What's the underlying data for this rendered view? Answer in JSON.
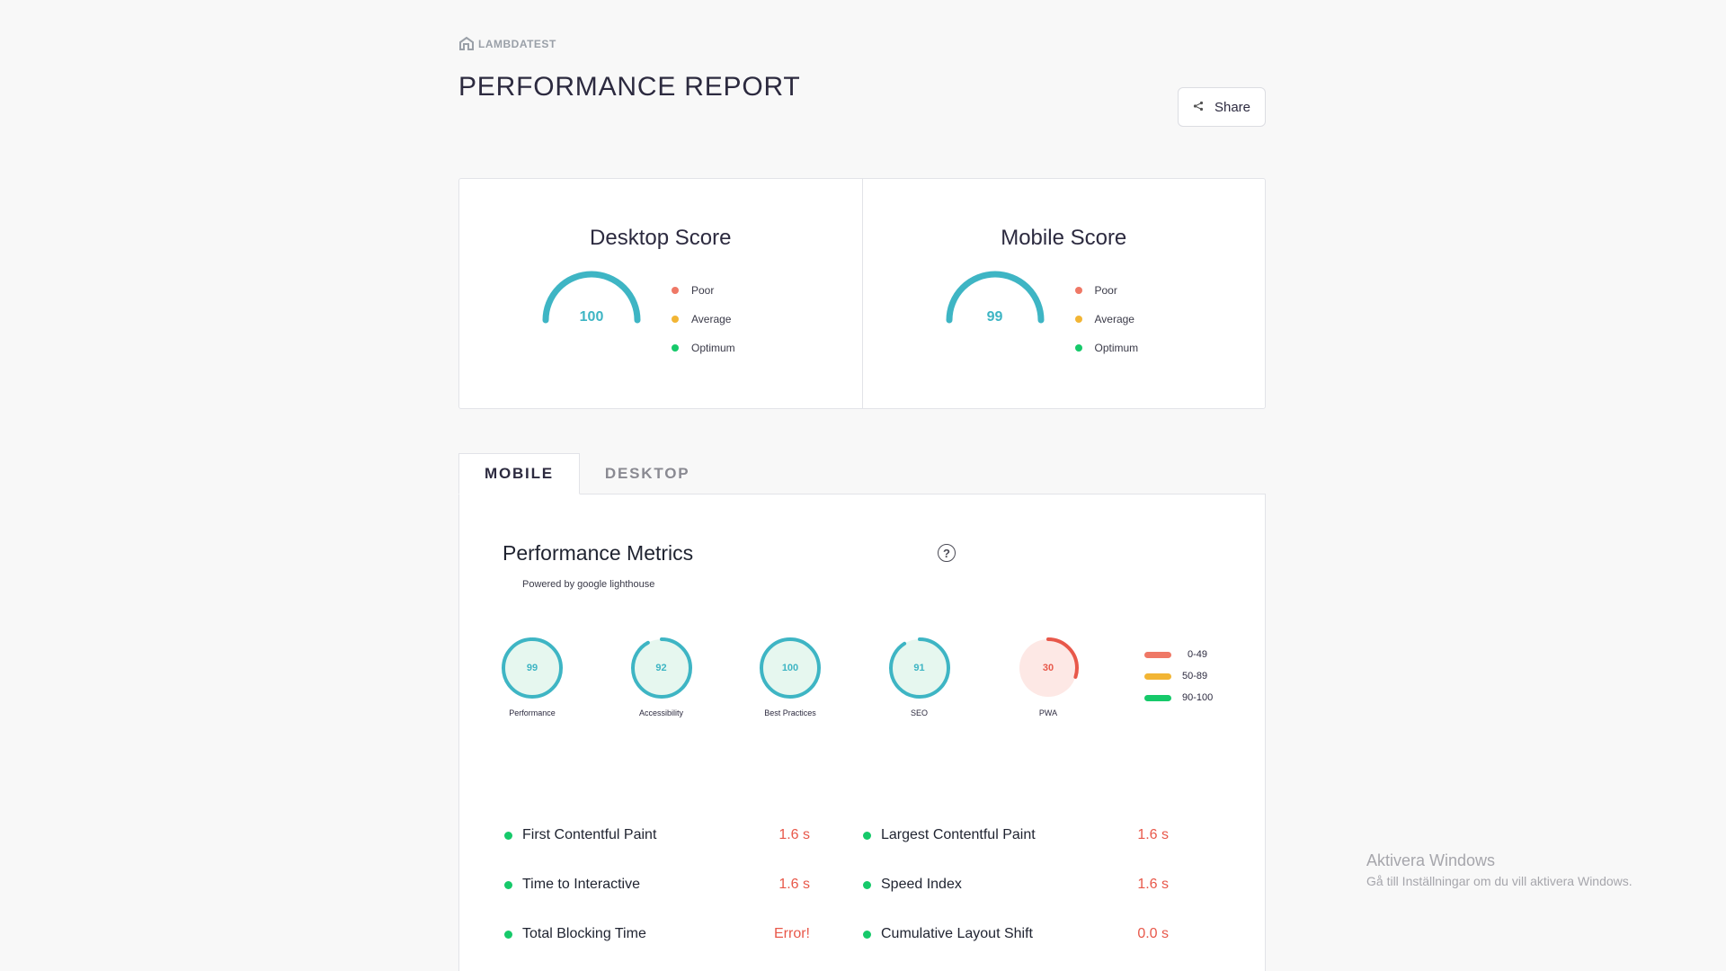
{
  "brand": {
    "name": "LAMBDATEST",
    "icon": "lambdatest-logo-icon"
  },
  "page": {
    "title": "PERFORMANCE REPORT"
  },
  "share": {
    "label": "Share",
    "icon": "share-icon"
  },
  "scores": {
    "desktop": {
      "title": "Desktop Score",
      "value": 100
    },
    "mobile": {
      "title": "Mobile Score",
      "value": 99
    },
    "legend": [
      {
        "label": "Poor",
        "color": "#ef7866"
      },
      {
        "label": "Average",
        "color": "#f2b534"
      },
      {
        "label": "Optimum",
        "color": "#16c96a"
      }
    ]
  },
  "tabs": [
    {
      "label": "MOBILE",
      "active": true
    },
    {
      "label": "DESKTOP",
      "active": false
    }
  ],
  "metrics": {
    "title": "Performance Metrics",
    "help_icon": "help-circle-icon",
    "powered_by": "Powered by google lighthouse",
    "categories": [
      {
        "label": "Performance",
        "value": 99
      },
      {
        "label": "Accessibility",
        "value": 92
      },
      {
        "label": "Best Practices",
        "value": 100
      },
      {
        "label": "SEO",
        "value": 91
      },
      {
        "label": "PWA",
        "value": 30
      }
    ],
    "ranges": [
      {
        "label": "0-49",
        "color": "#ef7866"
      },
      {
        "label": "50-89",
        "color": "#f2b534"
      },
      {
        "label": "90-100",
        "color": "#16c96a"
      }
    ],
    "rows": [
      {
        "name": "First Contentful Paint",
        "value": "1.6 s"
      },
      {
        "name": "Largest Contentful Paint",
        "value": "1.6 s"
      },
      {
        "name": "Time to Interactive",
        "value": "1.6 s"
      },
      {
        "name": "Speed Index",
        "value": "1.6 s"
      },
      {
        "name": "Total Blocking Time",
        "value": "Error!"
      },
      {
        "name": "Cumulative Layout Shift",
        "value": "0.0 s"
      }
    ]
  },
  "colors": {
    "gauge": "#3eb5c4",
    "good_fill": "#e6f7ef",
    "poor_fill": "#fde8e5",
    "poor_stroke": "#e8584a",
    "metric_value": "#e8584a"
  },
  "watermark": {
    "title": "Aktivera Windows",
    "subtitle": "Gå till Inställningar om du vill aktivera Windows."
  }
}
